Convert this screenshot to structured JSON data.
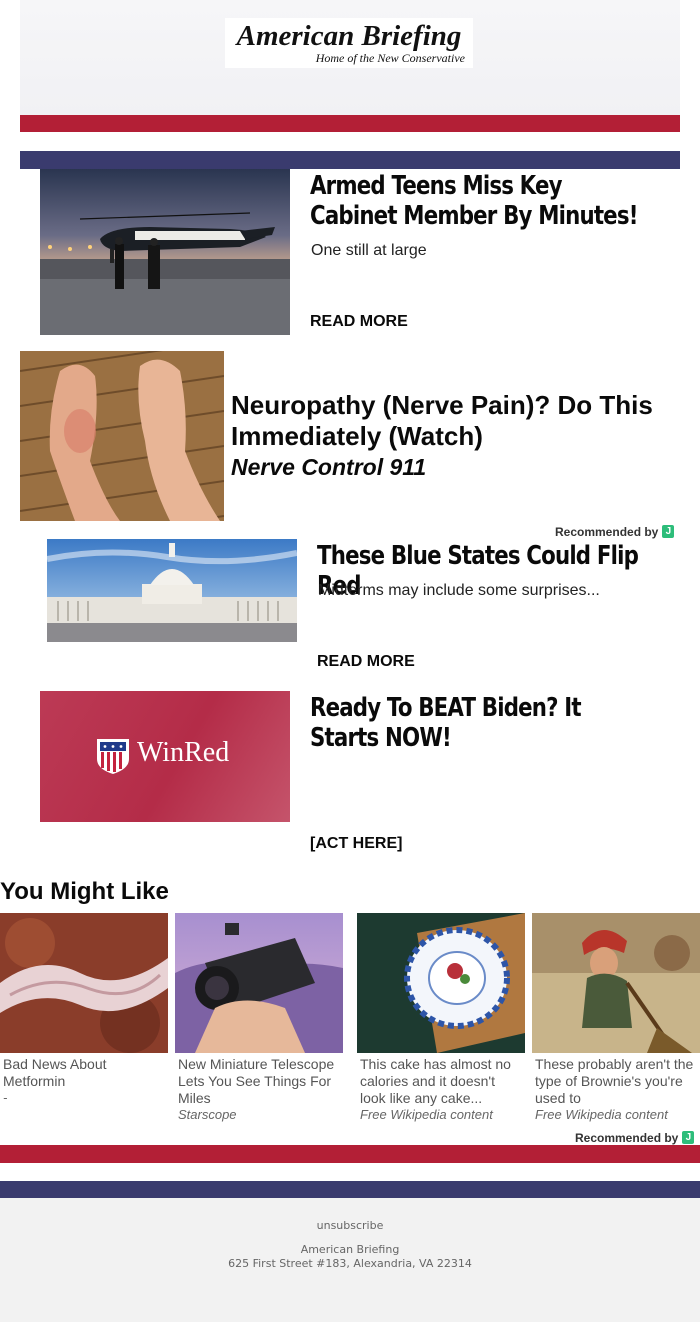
{
  "header": {
    "logo_title": "American Briefing",
    "logo_tagline": "Home of the New Conservative"
  },
  "colors": {
    "red": "#b31f36",
    "navy": "#3a3b6e",
    "green_badge": "#2dbd7a"
  },
  "articles": [
    {
      "headline": "Armed Teens Miss Key Cabinet Member By Minutes!",
      "description": "One still at large",
      "cta": "READ MORE",
      "image": "helicopter-on-tarmac-image"
    },
    {
      "headline": "These Blue States Could Flip Red",
      "description": "Midterms may include some surprises...",
      "cta": "READ MORE",
      "image": "capitol-building-image"
    },
    {
      "headline": "Ready To BEAT Biden? It Starts NOW!",
      "description": "",
      "cta": "[ACT HERE]",
      "image": "winred-logo-image"
    }
  ],
  "ad": {
    "headline": "Neuropathy (Nerve Pain)? Do This Immediately (Watch)",
    "sponsor": "Nerve Control 911",
    "image": "feet-on-deck-image"
  },
  "winred_logo_text": "WinRed",
  "recommended": {
    "label": "Recommended by",
    "badge": "J"
  },
  "you_might_like": {
    "heading": "You Might Like",
    "cards": [
      {
        "title": "Bad News About Metformin",
        "source": "-"
      },
      {
        "title": "New Miniature Telescope Lets You See Things For Miles",
        "source": "Starscope"
      },
      {
        "title": "This cake has almost no calories and it doesn't look like any cake...",
        "source": "Free Wikipedia content"
      },
      {
        "title": "These probably aren't the type of Brownie's you're used to",
        "source": "Free Wikipedia content"
      }
    ]
  },
  "footer": {
    "unsubscribe": "unsubscribe",
    "company": "American Briefing",
    "address": "625 First Street #183, Alexandria, VA 22314"
  }
}
